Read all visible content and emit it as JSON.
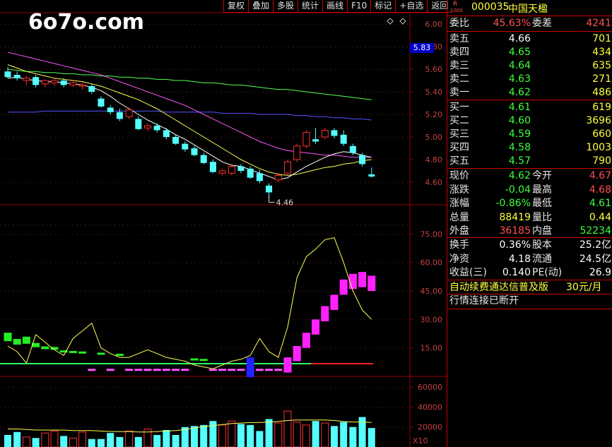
{
  "toolbar": {
    "items": [
      "复权",
      "叠加",
      "多股",
      "统计",
      "画线",
      "F10",
      "标记",
      "+自选",
      "返回"
    ]
  },
  "watermark": "6o7o.com",
  "price_tag": "5.83",
  "candle_axis": {
    "ticks": [
      "6.00",
      "5.80",
      "5.60",
      "5.40",
      "5.20",
      "5.00",
      "4.80",
      "4.60"
    ]
  },
  "low_label": "4.46",
  "indicator_axis": {
    "ticks": [
      "75.00",
      "60.00",
      "45.00",
      "30.00",
      "15.00"
    ]
  },
  "volume_axis": {
    "ticks": [
      "60000",
      "40000",
      "20000"
    ],
    "unit": "X10"
  },
  "colors": {
    "up": "#ff3030",
    "down": "#54ffff",
    "ma5": "#ffffff",
    "ma10": "#ffff55",
    "ma20": "#ff55ff",
    "ma60": "#55ff55",
    "ma120": "#5555ff",
    "grid": "#990000"
  },
  "stock": {
    "flag": "R",
    "flag_sub": "1000",
    "code": "000035",
    "name": "中国天楹"
  },
  "quote": {
    "weibi_label": "委比",
    "weibi": "45.63%",
    "weicha_label": "委差",
    "weicha": "4241",
    "sell": [
      {
        "label": "卖五",
        "price": "4.66",
        "vol": "701"
      },
      {
        "label": "卖四",
        "price": "4.65",
        "vol": "434"
      },
      {
        "label": "卖三",
        "price": "4.64",
        "vol": "635"
      },
      {
        "label": "卖二",
        "price": "4.63",
        "vol": "271"
      },
      {
        "label": "卖一",
        "price": "4.62",
        "vol": "486"
      }
    ],
    "buy": [
      {
        "label": "买一",
        "price": "4.61",
        "vol": "619"
      },
      {
        "label": "买二",
        "price": "4.60",
        "vol": "3696"
      },
      {
        "label": "买三",
        "price": "4.59",
        "vol": "660"
      },
      {
        "label": "买四",
        "price": "4.58",
        "vol": "1003"
      },
      {
        "label": "买五",
        "price": "4.57",
        "vol": "790"
      }
    ],
    "stats": [
      {
        "l1": "现价",
        "v1": "4.62",
        "l2": "今开",
        "v2": "4.67"
      },
      {
        "l1": "涨跌",
        "v1": "-0.04",
        "l2": "最高",
        "v2": "4.68"
      },
      {
        "l1": "涨幅",
        "v1": "-0.86%",
        "l2": "最低",
        "v2": "4.61"
      },
      {
        "l1": "总量",
        "v1": "88419",
        "l2": "量比",
        "v2": "0.44"
      },
      {
        "l1": "外盘",
        "v1": "36185",
        "l2": "内盘",
        "v2": "52234"
      }
    ],
    "fund": [
      {
        "l1": "换手",
        "v1": "0.36%",
        "l2": "股本",
        "v2": "25.2亿"
      },
      {
        "l1": "净资",
        "v1": "4.18",
        "l2": "流通",
        "v2": "24.5亿"
      },
      {
        "l1": "收益(三)",
        "v1": "0.140",
        "l2": "PE(动)",
        "v2": "26.9"
      }
    ],
    "promo": "自动续费通达信普及版",
    "promo_price": "30元/月",
    "status": "行情连接已断开"
  },
  "chart_data": {
    "type": "candlestick",
    "ylim": [
      4.4,
      6.1
    ],
    "candles": [
      [
        5.58,
        5.62,
        5.52,
        5.53
      ],
      [
        5.55,
        5.58,
        5.5,
        5.52
      ],
      [
        5.5,
        5.54,
        5.46,
        5.52
      ],
      [
        5.53,
        5.55,
        5.44,
        5.46
      ],
      [
        5.47,
        5.51,
        5.44,
        5.5
      ],
      [
        5.48,
        5.52,
        5.45,
        5.5
      ],
      [
        5.5,
        5.52,
        5.44,
        5.46
      ],
      [
        5.46,
        5.5,
        5.44,
        5.48
      ],
      [
        5.45,
        5.48,
        5.42,
        5.46
      ],
      [
        5.45,
        5.47,
        5.38,
        5.4
      ],
      [
        5.34,
        5.36,
        5.26,
        5.27
      ],
      [
        5.26,
        5.28,
        5.2,
        5.22
      ],
      [
        5.22,
        5.25,
        5.14,
        5.16
      ],
      [
        5.18,
        5.26,
        5.16,
        5.24
      ],
      [
        5.16,
        5.18,
        5.06,
        5.07
      ],
      [
        5.08,
        5.12,
        5.05,
        5.1
      ],
      [
        5.1,
        5.12,
        5.04,
        5.06
      ],
      [
        5.06,
        5.08,
        4.98,
        5.0
      ],
      [
        5.0,
        5.02,
        4.93,
        4.94
      ],
      [
        4.94,
        4.96,
        4.87,
        4.89
      ],
      [
        4.9,
        4.92,
        4.83,
        4.84
      ],
      [
        4.84,
        4.86,
        4.76,
        4.77
      ],
      [
        4.78,
        4.8,
        4.68,
        4.69
      ],
      [
        4.68,
        4.72,
        4.66,
        4.7
      ],
      [
        4.68,
        4.76,
        4.66,
        4.74
      ],
      [
        4.74,
        4.76,
        4.68,
        4.7
      ],
      [
        4.72,
        4.74,
        4.63,
        4.64
      ],
      [
        4.68,
        4.71,
        4.59,
        4.61
      ],
      [
        4.57,
        4.59,
        4.46,
        4.51
      ],
      [
        4.62,
        4.68,
        4.6,
        4.66
      ],
      [
        4.68,
        4.8,
        4.66,
        4.78
      ],
      [
        4.8,
        4.94,
        4.78,
        4.92
      ],
      [
        4.92,
        5.06,
        4.9,
        5.04
      ],
      [
        4.98,
        5.08,
        4.94,
        4.96
      ],
      [
        5.0,
        5.08,
        4.98,
        5.06
      ],
      [
        5.06,
        5.08,
        4.99,
        5.01
      ],
      [
        5.02,
        5.06,
        4.92,
        4.94
      ],
      [
        4.92,
        4.94,
        4.84,
        4.86
      ],
      [
        4.84,
        4.86,
        4.74,
        4.76
      ],
      [
        4.67,
        4.73,
        4.64,
        4.65
      ]
    ],
    "ma5": [
      5.52,
      5.53,
      5.51,
      5.5,
      5.49,
      5.49,
      5.48,
      5.47,
      5.46,
      5.44,
      5.41,
      5.36,
      5.3,
      5.25,
      5.2,
      5.15,
      5.11,
      5.07,
      5.02,
      4.98,
      4.93,
      4.88,
      4.83,
      4.78,
      4.75,
      4.74,
      4.71,
      4.68,
      4.65,
      4.62,
      4.64,
      4.69,
      4.74,
      4.78,
      4.82,
      4.85,
      4.87,
      4.86,
      4.84,
      4.82
    ],
    "ma10": [
      5.64,
      5.61,
      5.58,
      5.56,
      5.54,
      5.52,
      5.51,
      5.5,
      5.49,
      5.47,
      5.45,
      5.42,
      5.39,
      5.36,
      5.33,
      5.29,
      5.25,
      5.2,
      5.15,
      5.1,
      5.05,
      5.0,
      4.95,
      4.9,
      4.85,
      4.8,
      4.76,
      4.72,
      4.69,
      4.67,
      4.66,
      4.67,
      4.69,
      4.71,
      4.73,
      4.74,
      4.76,
      4.77,
      4.79,
      4.8
    ],
    "ma20": [
      5.75,
      5.73,
      5.71,
      5.69,
      5.67,
      5.65,
      5.63,
      5.61,
      5.59,
      5.57,
      5.55,
      5.52,
      5.49,
      5.46,
      5.43,
      5.4,
      5.37,
      5.34,
      5.31,
      5.28,
      5.24,
      5.2,
      5.16,
      5.12,
      5.08,
      5.04,
      5.0,
      4.96,
      4.93,
      4.9,
      4.88,
      4.87,
      4.86,
      4.85,
      4.84,
      4.84,
      4.83,
      4.82,
      4.82,
      4.82
    ],
    "ma60": [
      5.6,
      5.59,
      5.58,
      5.58,
      5.57,
      5.57,
      5.56,
      5.56,
      5.55,
      5.55,
      5.54,
      5.54,
      5.53,
      5.53,
      5.52,
      5.52,
      5.51,
      5.51,
      5.5,
      5.5,
      5.49,
      5.48,
      5.48,
      5.47,
      5.46,
      5.46,
      5.45,
      5.44,
      5.43,
      5.42,
      5.42,
      5.41,
      5.4,
      5.39,
      5.38,
      5.37,
      5.36,
      5.35,
      5.34,
      5.33
    ],
    "ma120": [
      5.22,
      5.22,
      5.22,
      5.22,
      5.23,
      5.23,
      5.23,
      5.23,
      5.23,
      5.23,
      5.23,
      5.23,
      5.23,
      5.23,
      5.23,
      5.23,
      5.23,
      5.22,
      5.22,
      5.22,
      5.22,
      5.22,
      5.22,
      5.21,
      5.21,
      5.21,
      5.21,
      5.2,
      5.2,
      5.2,
      5.2,
      5.19,
      5.19,
      5.18,
      5.18,
      5.17,
      5.17,
      5.16,
      5.16,
      5.15
    ],
    "indicator": {
      "ylim": [
        0,
        90
      ],
      "line": [
        16,
        13,
        7,
        22,
        18,
        14,
        11,
        20,
        24,
        28,
        15,
        12,
        10,
        10,
        12,
        14,
        12,
        10,
        9,
        8,
        6,
        5,
        4,
        6,
        8,
        9,
        11,
        20,
        13,
        10,
        26,
        52,
        63,
        67,
        72,
        73,
        60,
        45,
        35,
        30
      ],
      "bars": [
        -6,
        -4,
        -5,
        -3,
        -2,
        -2,
        -1,
        -1,
        -1,
        0,
        -1,
        0,
        -1,
        0,
        0,
        1,
        1,
        1,
        1,
        0,
        -1,
        -1,
        0,
        1,
        1,
        0,
        -10,
        2,
        1,
        3,
        8,
        14,
        21,
        28,
        35,
        41,
        49,
        52,
        53,
        51
      ]
    },
    "volume": {
      "ylim": [
        0,
        70000
      ],
      "values": [
        12000,
        15000,
        10000,
        9000,
        14000,
        16000,
        11000,
        9000,
        15000,
        8000,
        8000,
        14000,
        10000,
        16000,
        10000,
        18000,
        12000,
        17000,
        12000,
        20000,
        21000,
        22000,
        26000,
        22000,
        26000,
        23000,
        22000,
        16000,
        28000,
        24000,
        36000,
        25000,
        22000,
        26000,
        24000,
        21000,
        25000,
        20000,
        30000,
        19000
      ],
      "ma": [
        18000,
        18000,
        17500,
        17000,
        17000,
        17000,
        17000,
        16500,
        16500,
        16500,
        16000,
        15500,
        15500,
        15500,
        15000,
        15000,
        15500,
        16000,
        16500,
        17500,
        19000,
        20500,
        21500,
        22500,
        23500,
        24000,
        24500,
        24500,
        25000,
        25500,
        26500,
        27000,
        27000,
        27000,
        27000,
        26500,
        25500,
        25000,
        25000,
        24500
      ]
    }
  }
}
